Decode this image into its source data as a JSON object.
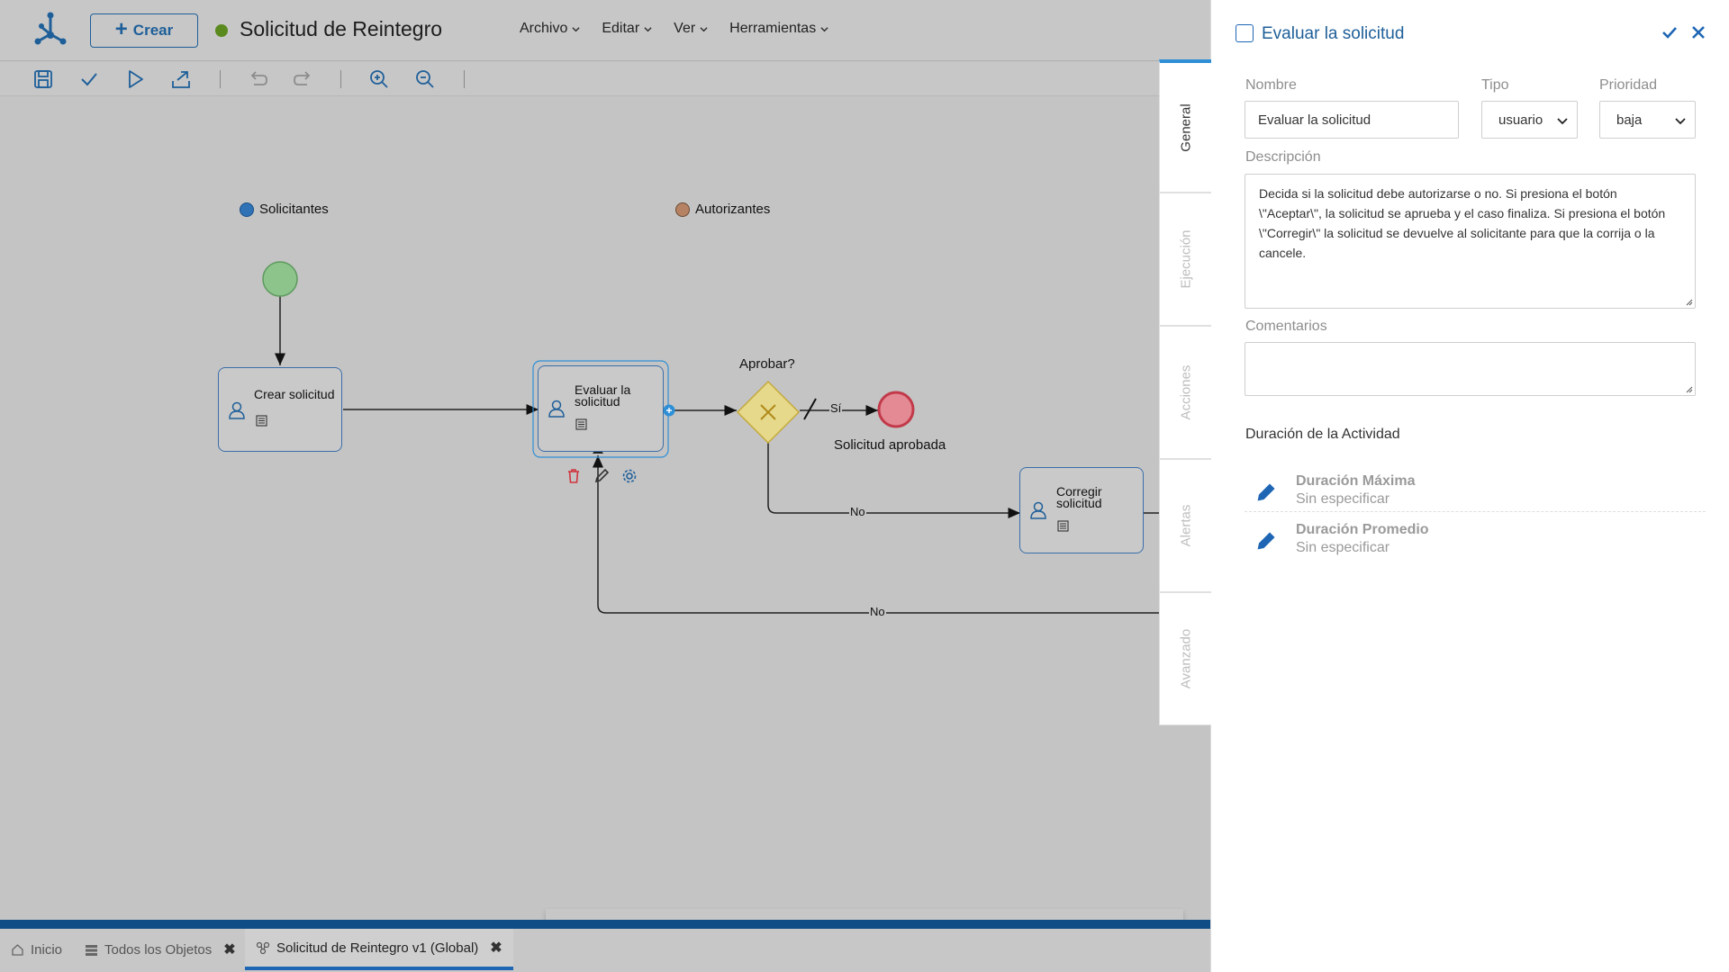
{
  "header": {
    "create_label": "Crear",
    "title": "Solicitud de Reintegro",
    "status_color": "#5a8a1e",
    "menu": [
      "Archivo",
      "Editar",
      "Ver",
      "Herramientas"
    ]
  },
  "toolbar": {
    "icons": [
      "save-icon",
      "check-icon",
      "play-icon",
      "export-icon",
      "undo-icon",
      "redo-icon",
      "zoom-in-icon",
      "zoom-out-icon"
    ]
  },
  "diagram": {
    "lanes": [
      "Solicitantes",
      "Autorizantes"
    ],
    "tasks": {
      "crear": "Crear solicitud",
      "evaluar_1": "Evaluar la",
      "evaluar_2": "solicitud",
      "corregir_1": "Corregir",
      "corregir_2": "solicitud"
    },
    "gateway_label": "Aprobar?",
    "end_label": "Solicitud aprobada",
    "edge_si": "Sí",
    "edge_no_1": "No",
    "edge_no_2": "No",
    "colors": {
      "start": "#8cc48c",
      "end": "#e48a95",
      "gateway": "#e6d98b",
      "task_border": "#3a6ea8"
    }
  },
  "palette": {
    "items": [
      "more-icon",
      "start-event-icon",
      "end-event-icon",
      "task-icon",
      "gateway-icon",
      "annotation-icon",
      "subprocess-icon",
      "intermediate-event-icon",
      "data-object-icon",
      "pool-icon"
    ]
  },
  "bottom_tabs": {
    "home": "Inicio",
    "all_objects": "Todos los Objetos",
    "current": "Solicitud de Reintegro v1 (Global)"
  },
  "panel": {
    "title": "Evaluar la solicitud",
    "tabs": [
      "General",
      "Ejecución",
      "Acciones",
      "Alertas",
      "Avanzado"
    ],
    "nombre_label": "Nombre",
    "nombre_value": "Evaluar la solicitud",
    "tipo_label": "Tipo",
    "tipo_value": "usuario",
    "prioridad_label": "Prioridad",
    "prioridad_value": "baja",
    "descripcion_label": "Descripción",
    "descripcion_value": "Decida si la solicitud debe autorizarse o no. Si presiona el botón \\\"Aceptar\\\", la solicitud se aprueba y el caso finaliza. Si presiona el botón \\\"Corregir\\\" la solicitud se devuelve al solicitante para que la corrija o la cancele.",
    "comentarios_label": "Comentarios",
    "comentarios_value": "",
    "duracion_title": "Duración de la Actividad",
    "duracion_maxima_label": "Duración Máxima",
    "duracion_maxima_value": "Sin especificar",
    "duracion_promedio_label": "Duración Promedio",
    "duracion_promedio_value": "Sin especificar"
  }
}
